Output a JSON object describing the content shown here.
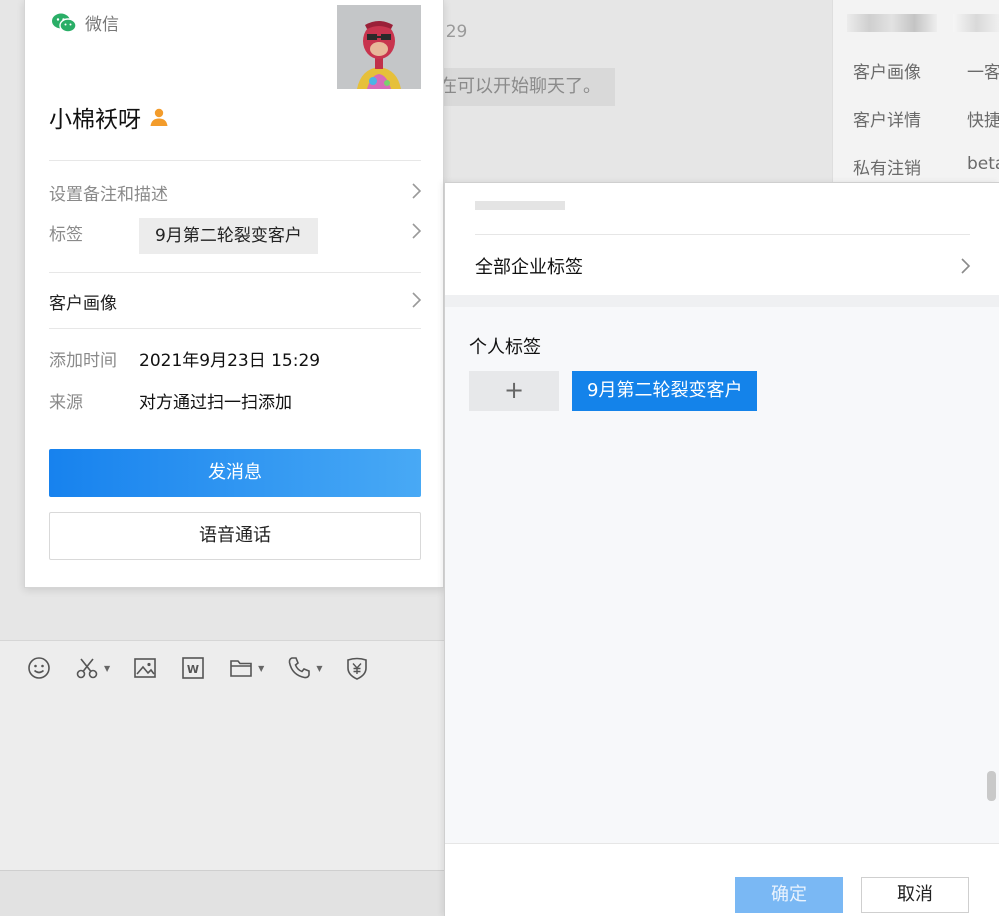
{
  "background": {
    "time_text": ":29",
    "bubble_text": "在可以开始聊天了。"
  },
  "side_panel": {
    "items": [
      "客户画像",
      "一客",
      "客户详情",
      "快捷",
      "私有注销",
      "beta"
    ]
  },
  "profile": {
    "source_label": "微信",
    "name": "小棉袄呀",
    "remark_label": "设置备注和描述",
    "tag_label": "标签",
    "tag_value": "9月第二轮裂变客户",
    "portrait_label": "客户画像",
    "added_time_label": "添加时间",
    "added_time_value": "2021年9月23日 15:29",
    "origin_label": "来源",
    "origin_value": "对方通过扫一扫添加",
    "send_message_label": "发消息",
    "voice_call_label": "语音通话"
  },
  "tag_dialog": {
    "all_tags_label": "全部企业标签",
    "personal_tags_title": "个人标签",
    "add_symbol": "+",
    "selected_tag": "9月第二轮裂变客户",
    "confirm_label": "确定",
    "cancel_label": "取消"
  },
  "toolbar": {
    "icons": [
      "emoji-icon",
      "scissors-icon",
      "image-icon",
      "word-doc-icon",
      "folder-icon",
      "phone-icon",
      "money-shield-icon"
    ]
  },
  "colors": {
    "primary": "#1483ea",
    "wechat_green": "#2aae67",
    "person_orange": "#f39c2b"
  }
}
